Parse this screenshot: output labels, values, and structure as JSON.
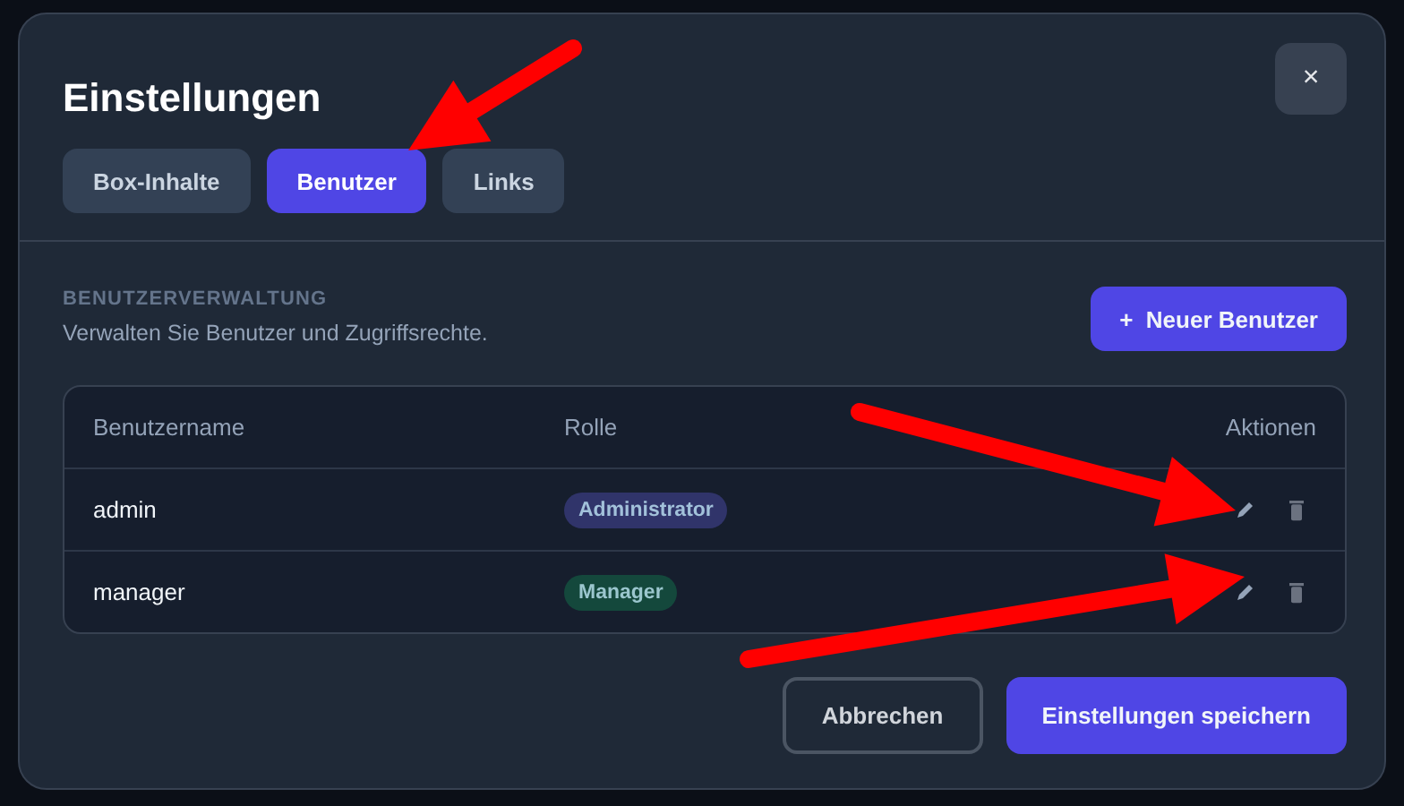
{
  "dialog": {
    "title": "Einstellungen",
    "close": "×"
  },
  "tabs": [
    {
      "label": "Box-Inhalte",
      "selected": false
    },
    {
      "label": "Benutzer",
      "selected": true
    },
    {
      "label": "Links",
      "selected": false
    }
  ],
  "section": {
    "heading": "BENUTZERVERWALTUNG",
    "description": "Verwalten Sie Benutzer und Zugriffsrechte.",
    "add_button": "+  Neuer Benutzer"
  },
  "table": {
    "columns": [
      "Benutzername",
      "Rolle",
      "Aktionen"
    ],
    "rows": [
      {
        "username": "admin",
        "role": "Administrator",
        "color": "#30346a"
      },
      {
        "username": "manager",
        "role": "Manager",
        "color": "#14483c"
      }
    ]
  },
  "footer": {
    "buttons": [
      {
        "label": "Abbrechen",
        "kind": "secondary"
      },
      {
        "label": "Einstellungen speichern",
        "kind": "primary"
      }
    ]
  }
}
